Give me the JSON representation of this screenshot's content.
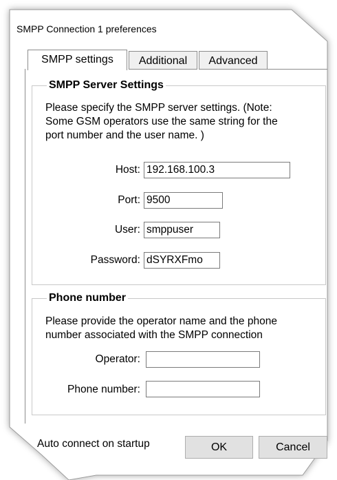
{
  "window": {
    "title": "SMPP Connection 1 preferences"
  },
  "tabs": [
    {
      "label": "SMPP settings",
      "active": true
    },
    {
      "label": "Additional",
      "active": false
    },
    {
      "label": "Advanced",
      "active": false
    }
  ],
  "server_group": {
    "title": "SMPP Server Settings",
    "description_lines": [
      "Please specify the SMPP server settings. (Note:",
      "Some GSM operators use the same string for the",
      "port number and the user name. )"
    ],
    "host": {
      "label": "Host:",
      "value": "192.168.100.3"
    },
    "port": {
      "label": "Port:",
      "value": "9500"
    },
    "user": {
      "label": "User:",
      "value": "smppuser"
    },
    "password": {
      "label": "Password:",
      "value": "dSYRXFmo"
    }
  },
  "phone_group": {
    "title": "Phone number",
    "description_lines": [
      "Please provide the operator name and the phone",
      "number associated with the SMPP connection"
    ],
    "operator": {
      "label": "Operator:",
      "value": ""
    },
    "phone_number": {
      "label": "Phone number:",
      "value": ""
    }
  },
  "footer": {
    "auto_connect_label": "Auto connect on startup",
    "ok_label": "OK",
    "cancel_label": "Cancel"
  },
  "colors": {
    "window_background": "#ffffff",
    "tab_inactive": "#f0f0f0",
    "button_face": "#e1e1e1",
    "border": "#8c8c8c"
  }
}
